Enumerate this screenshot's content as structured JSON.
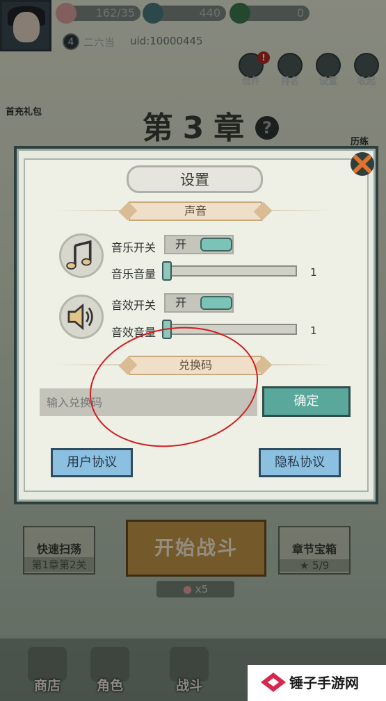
{
  "hud": {
    "stamina": "162/35",
    "coins": "440",
    "gems": "0",
    "level": "4",
    "player_name": "二六当",
    "uid": "uid:10000445"
  },
  "top_buttons": {
    "mail": "信件",
    "rank": "排名",
    "settings": "设置",
    "collapse": "收起",
    "badge": "!"
  },
  "chapter": {
    "title": "第3章",
    "help": "?",
    "left_label": "首充礼包",
    "right_label": "历练"
  },
  "settings": {
    "title": "设置",
    "sound_section": "声音",
    "music_toggle_label": "音乐开关",
    "music_toggle_value": "开",
    "music_volume_label": "音乐音量",
    "music_volume_value": "1",
    "sfx_toggle_label": "音效开关",
    "sfx_toggle_value": "开",
    "sfx_volume_label": "音效音量",
    "sfx_volume_value": "1",
    "redeem_section": "兑换码",
    "redeem_placeholder": "输入兑换码",
    "confirm": "确定",
    "user_agreement": "用户协议",
    "privacy_policy": "隐私协议"
  },
  "bottom": {
    "sweep_title": "快速扫荡",
    "sweep_sub": "第1章第2关",
    "start_battle": "开始战斗",
    "chest_title": "章节宝箱",
    "chest_sub": "5/9",
    "cost": "x5"
  },
  "nav": {
    "shop": "商店",
    "role": "角色",
    "battle": "战斗"
  },
  "watermark": "锤子手游网",
  "colors": {
    "accent_teal": "#5aa79c",
    "link_blue": "#8cc0e1",
    "annotation_red": "#d11e1e"
  }
}
